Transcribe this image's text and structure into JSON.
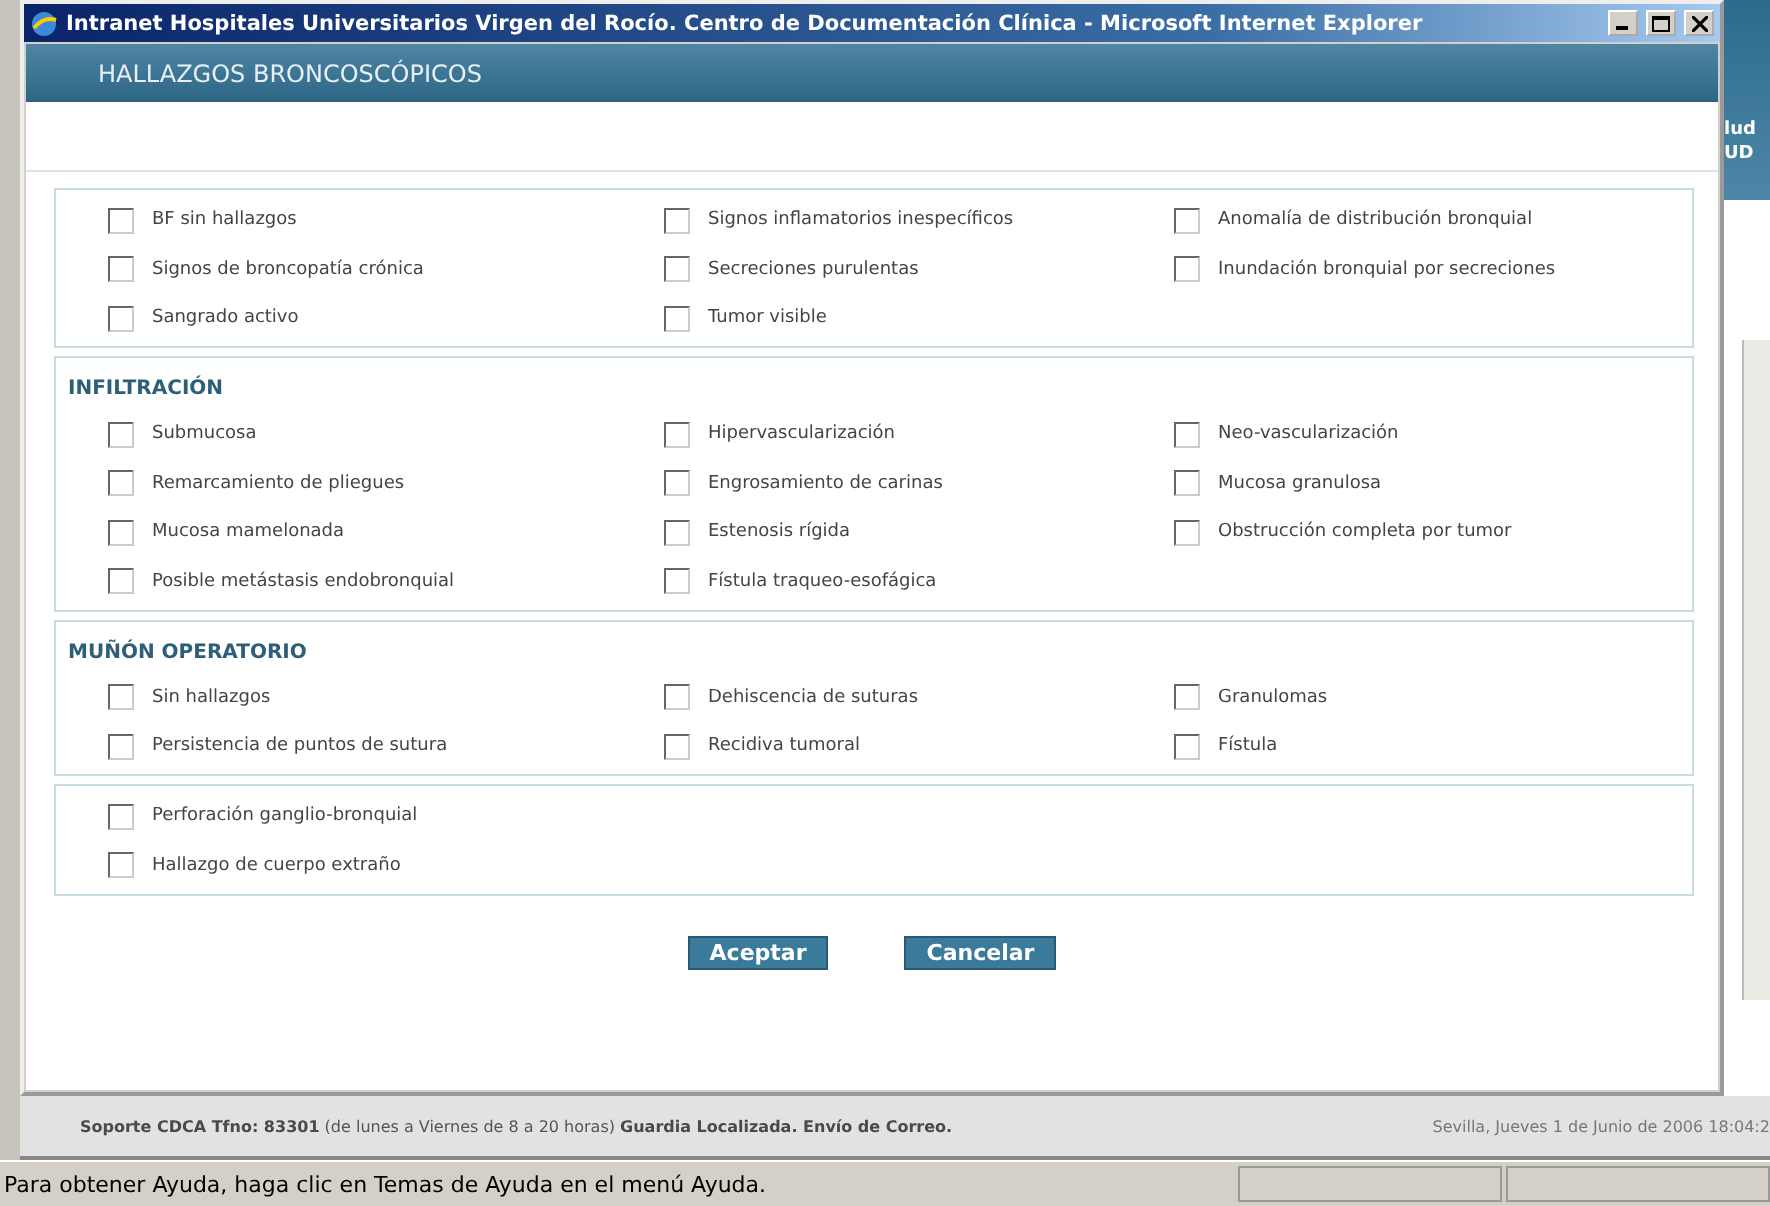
{
  "window": {
    "title": "Intranet Hospitales Universitarios Virgen del Rocío. Centro de Documentación Clínica - Microsoft Internet Explorer"
  },
  "header": "HALLAZGOS BRONCOSCÓPICOS",
  "sections": [
    {
      "options": [
        {
          "label": "BF sin hallazgos",
          "checked": false
        },
        {
          "label": "Signos inflamatorios inespecíficos",
          "checked": false
        },
        {
          "label": "Anomalía de distribución bronquial",
          "checked": false
        },
        {
          "label": "Signos de broncopatía crónica",
          "checked": false
        },
        {
          "label": "Secreciones purulentas",
          "checked": false
        },
        {
          "label": "Inundación bronquial por secreciones",
          "checked": false
        },
        {
          "label": "Sangrado activo",
          "checked": false
        },
        {
          "label": "Tumor visible",
          "checked": false
        }
      ]
    },
    {
      "title": "INFILTRACIÓN",
      "options": [
        {
          "label": "Submucosa",
          "checked": false
        },
        {
          "label": "Hipervascularización",
          "checked": false
        },
        {
          "label": "Neo-vascularización",
          "checked": false
        },
        {
          "label": "Remarcamiento de pliegues",
          "checked": false
        },
        {
          "label": "Engrosamiento de carinas",
          "checked": false
        },
        {
          "label": "Mucosa granulosa",
          "checked": false
        },
        {
          "label": "Mucosa mamelonada",
          "checked": false
        },
        {
          "label": "Estenosis rígida",
          "checked": false
        },
        {
          "label": "Obstrucción completa por tumor",
          "checked": false
        },
        {
          "label": "Posible metástasis endobronquial",
          "checked": false
        },
        {
          "label": "Fístula traqueo-esofágica",
          "checked": false
        }
      ]
    },
    {
      "title": "MUÑÓN OPERATORIO",
      "options": [
        {
          "label": "Sin hallazgos",
          "checked": false
        },
        {
          "label": "Dehiscencia de suturas",
          "checked": false
        },
        {
          "label": "Granulomas",
          "checked": false
        },
        {
          "label": "Persistencia de puntos de sutura",
          "checked": false
        },
        {
          "label": "Recidiva tumoral",
          "checked": false
        },
        {
          "label": "Fístula",
          "checked": false
        }
      ]
    },
    {
      "single_column": true,
      "options": [
        {
          "label": "Perforación ganglio-bronquial",
          "checked": false
        },
        {
          "label": "Hallazgo de cuerpo extraño",
          "checked": false
        }
      ]
    }
  ],
  "buttons": [
    "Aceptar",
    "Cancelar"
  ],
  "background": {
    "side_texts": [
      "lud",
      "UD"
    ],
    "support": "**Soporte CDCA Tfno: 83301** (de lunes a Viernes de 8 a 20 horas) **Guardia Localizada.   Envío de Correo.**",
    "date": "Sevilla, Jueves 1 de Junio de 2006 18:04:2"
  },
  "status_bar": "Para obtener Ayuda, haga clic en Temas de Ayuda en el menú Ayuda."
}
